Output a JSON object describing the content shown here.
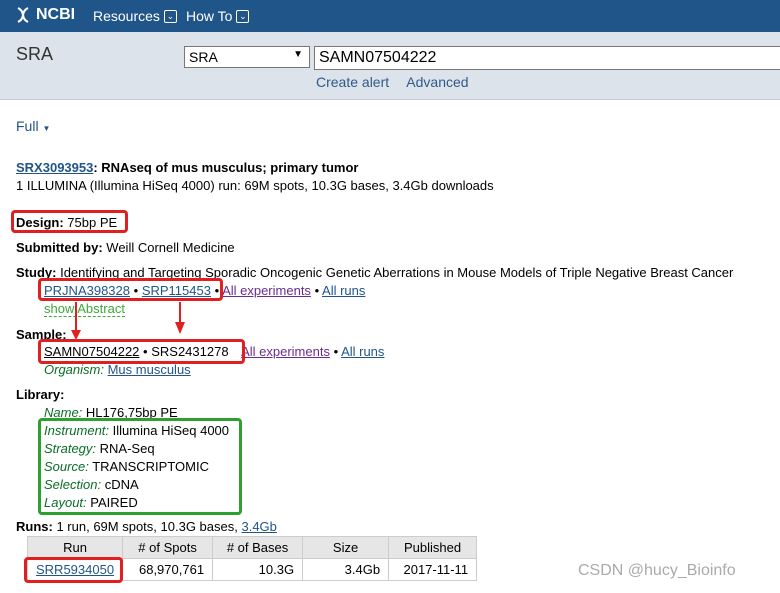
{
  "topbar": {
    "logo_text": "NCBI",
    "resources_label": "Resources",
    "howto_label": "How To"
  },
  "search": {
    "db_title": "SRA",
    "db_select_value": "SRA",
    "query": "SAMN07504222",
    "create_alert": "Create alert",
    "advanced": "Advanced"
  },
  "view": {
    "format": "Full"
  },
  "experiment": {
    "accession": "SRX3093953",
    "title": ": RNAseq of mus musculus; primary tumor",
    "summary": "1 ILLUMINA (Illumina HiSeq 4000) run: 69M spots, 10.3G bases, 3.4Gb downloads",
    "design_label": "Design:",
    "design_value": "75bp PE",
    "submitted_label": "Submitted by:",
    "submitted_value": "Weill Cornell Medicine",
    "study_label": "Study:",
    "study_title": "Identifying and Targeting Sporadic Oncogenic Genetic Aberrations in Mouse Models of Triple Negative Breast Cancer",
    "study_prjna": "PRJNA398328",
    "study_srp": "SRP115453",
    "all_experiments": "All experiments",
    "all_runs": "All runs",
    "show_abstract": "show Abstract",
    "sample_label": "Sample:",
    "sample_samn": "SAMN07504222",
    "sample_srs": "SRS2431278",
    "organism_label": "Organism:",
    "organism_value": "Mus musculus",
    "library_label": "Library:",
    "library": {
      "name_label": "Name:",
      "name_value": "HL176,75bp PE",
      "instrument_label": "Instrument:",
      "instrument_value": "Illumina HiSeq 4000",
      "strategy_label": "Strategy:",
      "strategy_value": "RNA-Seq",
      "source_label": "Source:",
      "source_value": "TRANSCRIPTOMIC",
      "selection_label": "Selection:",
      "selection_value": "cDNA",
      "layout_label": "Layout:",
      "layout_value": "PAIRED"
    },
    "runs_label": "Runs:",
    "runs_summary": "1 run, 69M spots, 10.3G bases,",
    "runs_download": "3.4Gb"
  },
  "runs_table": {
    "headers": [
      "Run",
      "# of Spots",
      "# of Bases",
      "Size",
      "Published"
    ],
    "rows": [
      [
        "SRR5934050",
        "68,970,761",
        "10.3G",
        "3.4Gb",
        "2017-11-11"
      ]
    ]
  },
  "separator": "•",
  "watermark": "CSDN @hucy_Bioinfo",
  "colors": {
    "topbar": "#20558a",
    "link": "#20558a",
    "visited_link": "#6a2c91",
    "annotation_red": "#e02020",
    "annotation_green": "#2ea030"
  }
}
